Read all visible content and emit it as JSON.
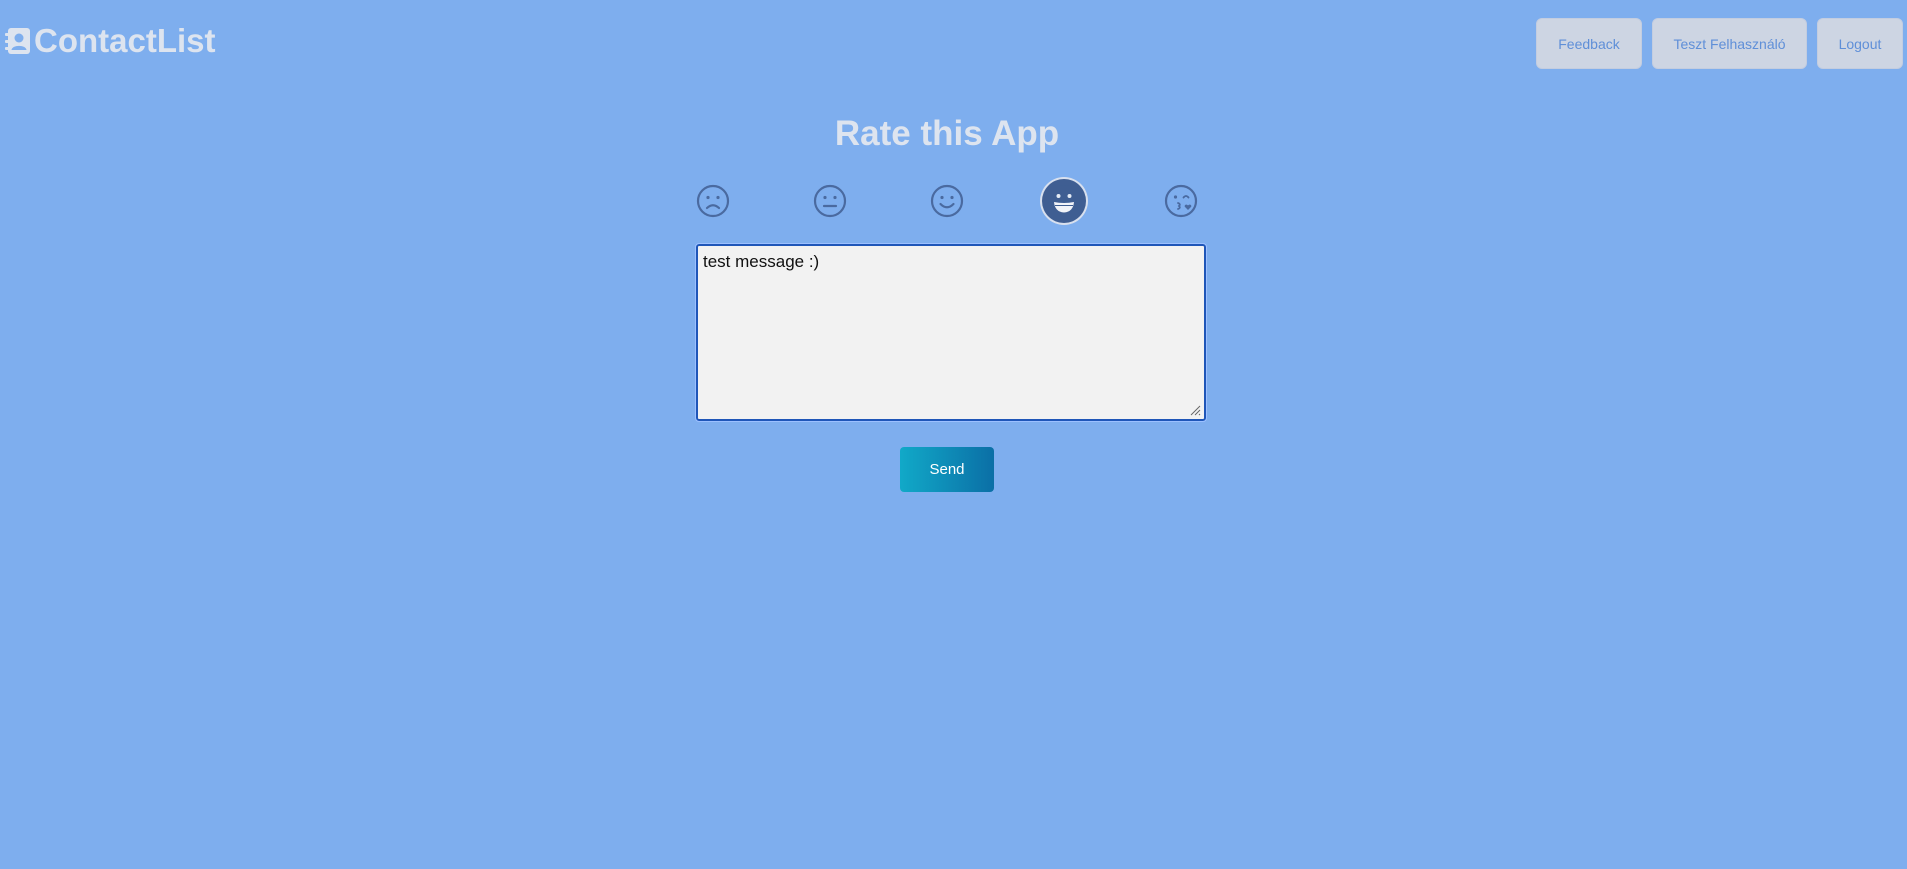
{
  "brand": {
    "name": "ContactList",
    "icon": "contact-card-icon"
  },
  "nav": {
    "feedback_label": "Feedback",
    "user_label": "Teszt Felhasználó",
    "logout_label": "Logout"
  },
  "rating": {
    "title": "Rate this App",
    "options": [
      {
        "icon": "frown-icon"
      },
      {
        "icon": "neutral-face-icon"
      },
      {
        "icon": "smile-icon"
      },
      {
        "icon": "grin-icon",
        "selected": true
      },
      {
        "icon": "kiss-wink-icon"
      }
    ],
    "selected_index": 3
  },
  "message": {
    "value": "test message :)"
  },
  "send_label": "Send",
  "colors": {
    "background": "#7eaeee",
    "nav_button": "#cdd5e3",
    "nav_text": "#5f8fd8",
    "emoji_stroke": "#4a6aa0",
    "send_gradient_start": "#11a9c8",
    "send_gradient_end": "#0b6fa6"
  }
}
